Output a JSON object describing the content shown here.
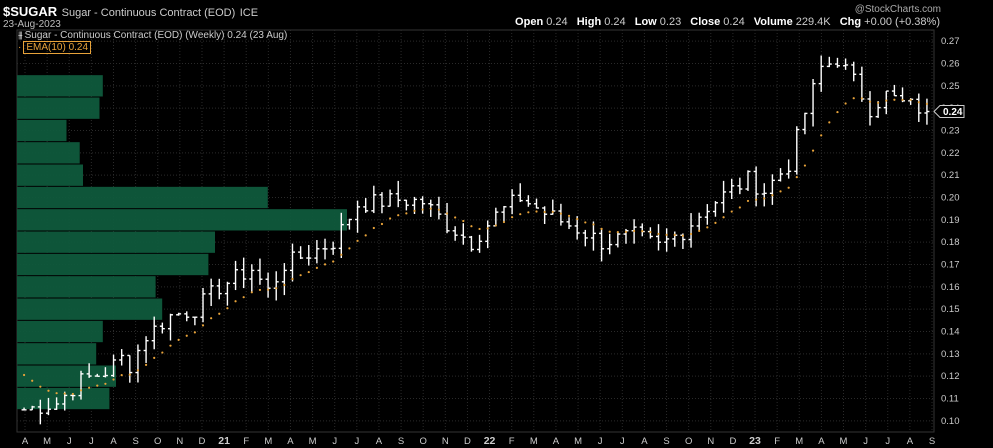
{
  "header": {
    "ticker": "$SUGAR",
    "contract": "Sugar - Continuous Contract (EOD)",
    "exchange": "ICE",
    "date": "23-Aug-2023",
    "brand": "@StockCharts.com",
    "open_label": "Open",
    "open_value": "0.24",
    "high_label": "High",
    "high_value": "0.24",
    "low_label": "Low",
    "low_value": "0.23",
    "close_label": "Close",
    "close_value": "0.24",
    "volume_label": "Volume",
    "volume_value": "229.4K",
    "chg_label": "Chg",
    "chg_value": "+0.00 (+0.38%)"
  },
  "legend": {
    "price_line": "Sugar - Continuous Contract (EOD) (Weekly) 0.24 (23 Aug)",
    "ema_label": "EMA(10) 0.24"
  },
  "colors": {
    "background": "#000000",
    "price_bars": "#ffffff",
    "ema": "#e8a33a",
    "volume_profile": "#0f5a3c",
    "grid": "#2a2a2a",
    "last_badge": "#cccccc"
  },
  "chart_data": {
    "type": "ohlc",
    "title": "Sugar - Continuous Contract (EOD) (Weekly)",
    "y_axis": {
      "ticks": [
        "0.10",
        "0.11",
        "0.12",
        "0.13",
        "0.14",
        "0.15",
        "0.16",
        "0.17",
        "0.18",
        "0.19",
        "0.20",
        "0.21",
        "0.22",
        "0.23",
        "0.24",
        "0.25",
        "0.26",
        "0.27"
      ],
      "ylim": [
        0.095,
        0.275
      ],
      "last_value_badge": "0.24"
    },
    "x_axis": {
      "labels": [
        "A",
        "M",
        "J",
        "J",
        "A",
        "S",
        "O",
        "N",
        "D",
        "21",
        "F",
        "M",
        "A",
        "M",
        "J",
        "J",
        "A",
        "S",
        "O",
        "N",
        "D",
        "22",
        "F",
        "M",
        "A",
        "M",
        "J",
        "J",
        "A",
        "S",
        "O",
        "N",
        "D",
        "23",
        "F",
        "M",
        "A",
        "M",
        "J",
        "J",
        "A",
        "S"
      ]
    },
    "grid": "on",
    "price_control_points": [
      [
        0,
        0.105
      ],
      [
        4,
        0.108
      ],
      [
        7,
        0.118
      ],
      [
        10,
        0.122
      ],
      [
        12,
        0.128
      ],
      [
        13,
        0.125
      ],
      [
        15,
        0.138
      ],
      [
        18,
        0.147
      ],
      [
        21,
        0.15
      ],
      [
        24,
        0.16
      ],
      [
        28,
        0.168
      ],
      [
        30,
        0.158
      ],
      [
        32,
        0.17
      ],
      [
        35,
        0.175
      ],
      [
        38,
        0.18
      ],
      [
        41,
        0.197
      ],
      [
        46,
        0.199
      ],
      [
        49,
        0.198
      ],
      [
        52,
        0.188
      ],
      [
        55,
        0.18
      ],
      [
        58,
        0.192
      ],
      [
        61,
        0.2
      ],
      [
        64,
        0.193
      ],
      [
        68,
        0.186
      ],
      [
        71,
        0.18
      ],
      [
        75,
        0.183
      ],
      [
        78,
        0.178
      ],
      [
        81,
        0.185
      ],
      [
        84,
        0.196
      ],
      [
        86,
        0.201
      ],
      [
        89,
        0.208
      ],
      [
        91,
        0.203
      ],
      [
        94,
        0.215
      ],
      [
        96,
        0.238
      ],
      [
        98,
        0.258
      ],
      [
        100,
        0.262
      ],
      [
        102,
        0.252
      ],
      [
        104,
        0.24
      ],
      [
        106,
        0.246
      ],
      [
        108,
        0.242
      ],
      [
        110,
        0.24
      ],
      [
        111,
        0.238
      ]
    ],
    "ema_label": "EMA(10)",
    "ema_last": 0.24,
    "volume_profile": [
      {
        "low": 0.105,
        "high": 0.115,
        "value": 0.28
      },
      {
        "low": 0.115,
        "high": 0.125,
        "value": 0.3
      },
      {
        "low": 0.125,
        "high": 0.135,
        "value": 0.24
      },
      {
        "low": 0.135,
        "high": 0.145,
        "value": 0.26
      },
      {
        "low": 0.145,
        "high": 0.155,
        "value": 0.44
      },
      {
        "low": 0.155,
        "high": 0.165,
        "value": 0.42
      },
      {
        "low": 0.165,
        "high": 0.175,
        "value": 0.58
      },
      {
        "low": 0.175,
        "high": 0.185,
        "value": 0.6
      },
      {
        "low": 0.185,
        "high": 0.195,
        "value": 1.0
      },
      {
        "low": 0.195,
        "high": 0.205,
        "value": 0.76
      },
      {
        "low": 0.205,
        "high": 0.215,
        "value": 0.2
      },
      {
        "low": 0.215,
        "high": 0.225,
        "value": 0.19
      },
      {
        "low": 0.225,
        "high": 0.235,
        "value": 0.15
      },
      {
        "low": 0.235,
        "high": 0.245,
        "value": 0.25
      },
      {
        "low": 0.245,
        "high": 0.255,
        "value": 0.26
      }
    ]
  }
}
